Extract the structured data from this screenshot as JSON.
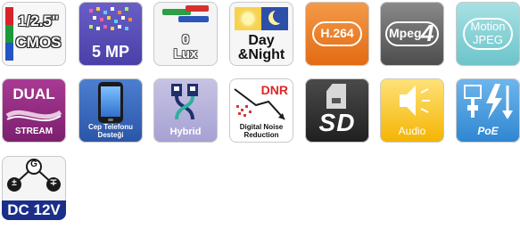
{
  "tiles": {
    "cmos": {
      "line1": "1/2.5\"",
      "line2": "CMOS"
    },
    "mp": {
      "label": "5 MP"
    },
    "lux": {
      "value": "0",
      "unit": "Lux"
    },
    "daynight": {
      "line1": "Day",
      "line2": "&Night"
    },
    "h264": {
      "label": "H.264"
    },
    "mpeg4": {
      "label": "Mpeg",
      "num": "4"
    },
    "mjpeg": {
      "line1": "Motion",
      "line2": "JPEG"
    },
    "dual": {
      "line1": "DUAL",
      "line2": "STREAM"
    },
    "phone": {
      "line1": "Cep Telefonu",
      "line2": "Desteği"
    },
    "hybrid": {
      "label": "Hybrid"
    },
    "dnr": {
      "badge": "DNR",
      "line1": "Digital Noise",
      "line2": "Reduction"
    },
    "sd": {
      "label": "SD"
    },
    "audio": {
      "label": "Audio"
    },
    "poe": {
      "label": "PoE"
    },
    "dc": {
      "label": "DC 12V",
      "ground": "G",
      "plus": "±",
      "minus": "∓"
    }
  },
  "colors": {
    "cmos_bars": [
      "#d8232a",
      "#1a9a3a",
      "#2455c8"
    ],
    "mp_purple": "#5a4fbf",
    "h264_orange": "#ee7b22",
    "mjpeg_teal": "#8fd3d7",
    "dual_purple": "#8e2a80",
    "hybrid_lavender": "#b8b3dc",
    "audio_yellow": "#f7c531",
    "poe_blue": "#3c95dc",
    "dc_navy": "#1b2f8a"
  }
}
